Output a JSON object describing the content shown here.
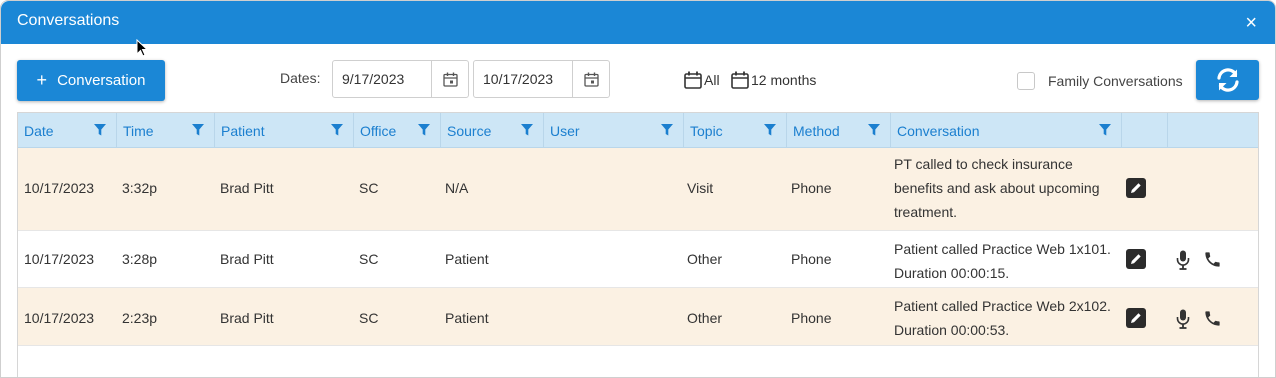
{
  "window": {
    "title": "Conversations",
    "close_label": "×"
  },
  "toolbar": {
    "add_label": "Conversation",
    "dates_label": "Dates:",
    "date_from": "9/17/2023",
    "date_to": "10/17/2023",
    "range_all": "All",
    "range_12": "12 months",
    "family_label": "Family Conversations",
    "family_checked": false
  },
  "columns": [
    "Date",
    "Time",
    "Patient",
    "Office",
    "Source",
    "User",
    "Topic",
    "Method",
    "Conversation"
  ],
  "rows": [
    {
      "date": "10/17/2023",
      "time": "3:32p",
      "patient": "Brad Pitt",
      "office": "SC",
      "source": "N/A",
      "user": "",
      "topic": "Visit",
      "method": "Phone",
      "conversation": "PT called to check insurance benefits and ask about upcoming treatment."
    },
    {
      "date": "10/17/2023",
      "time": "3:28p",
      "patient": "Brad Pitt",
      "office": "SC",
      "source": "Patient",
      "user": "",
      "topic": "Other",
      "method": "Phone",
      "conversation": "Patient called Practice Web 1x101. Duration 00:00:15."
    },
    {
      "date": "10/17/2023",
      "time": "2:23p",
      "patient": "Brad Pitt",
      "office": "SC",
      "source": "Patient",
      "user": "",
      "topic": "Other",
      "method": "Phone",
      "conversation": "Patient called Practice Web 2x102. Duration 00:00:53."
    }
  ],
  "colors": {
    "accent": "#1b87d6",
    "header_bg": "#cde6f6",
    "row_alt": "#fbf1e3"
  },
  "icons": [
    "filter-icon",
    "calendar-icon",
    "edit-icon",
    "microphone-icon",
    "phone-icon",
    "refresh-icon",
    "close-icon"
  ]
}
